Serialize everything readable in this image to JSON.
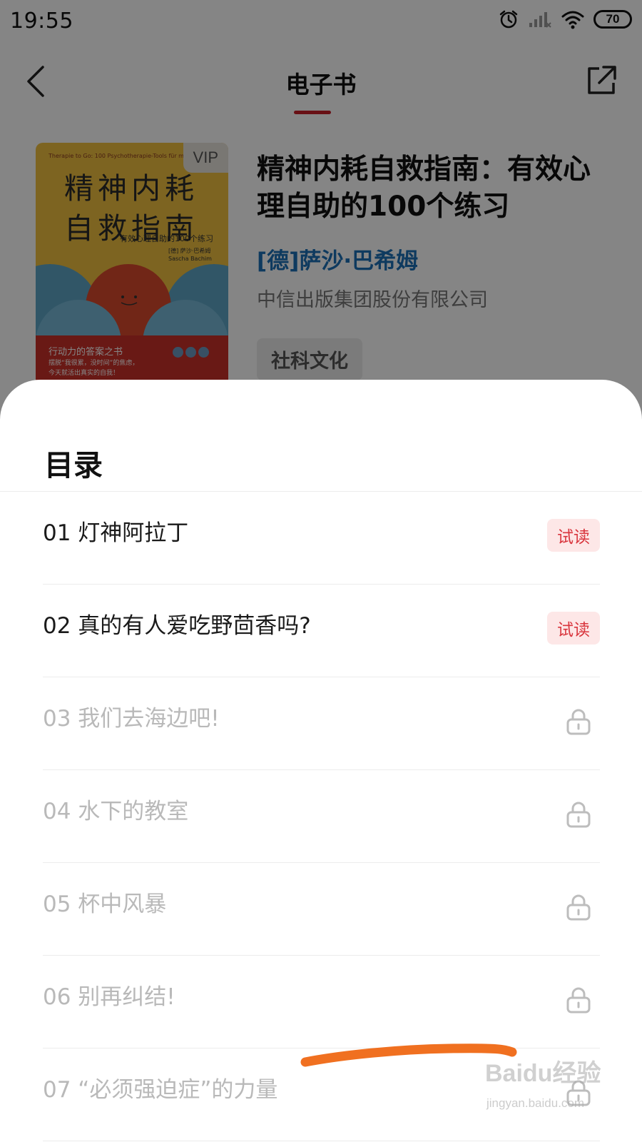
{
  "status_bar": {
    "time": "19:55",
    "battery": "70"
  },
  "header": {
    "title": "电子书"
  },
  "book": {
    "vip_label": "VIP",
    "cover": {
      "english_subtitle": "Therapie to Go: 100 Psychotherapie-Tools für mehr Leichtigkeit",
      "title_line1": "精神内耗",
      "title_line2": "自救指南",
      "subtitle": "有效心理自助的100个练习",
      "author_line1": "[德] 萨沙·巴希姆",
      "author_line2": "Sascha Bachim",
      "band_title": "行动力的答案之书",
      "band_line1": "摆脱“我很累，没时间”的焦虑，",
      "band_line2": "今天就活出真实的自我！"
    },
    "title": "精神内耗自救指南：有效心理自助的100个练习",
    "author": "[德]萨沙·巴希姆",
    "publisher": "中信出版集团股份有限公司",
    "category": "社科文化"
  },
  "toc": {
    "heading": "目录",
    "trial_label": "试读",
    "items": [
      {
        "label": "01 灯神阿拉丁",
        "state": "trial"
      },
      {
        "label": "02 真的有人爱吃野茴香吗?",
        "state": "trial"
      },
      {
        "label": "03 我们去海边吧!",
        "state": "locked"
      },
      {
        "label": "04 水下的教室",
        "state": "locked"
      },
      {
        "label": "05 杯中风暴",
        "state": "locked"
      },
      {
        "label": "06 别再纠结!",
        "state": "locked"
      },
      {
        "label": "07 “必须强迫症”的力量",
        "state": "locked"
      }
    ]
  },
  "watermark": {
    "logo_text": "Baidu经验",
    "url": "jingyan.baidu.com"
  },
  "colors": {
    "accent": "#c8202a",
    "author_link": "#1b6fb6",
    "trial_text": "#d9363e",
    "trial_bg": "#fde7e7",
    "locked_text": "#b9b9b9",
    "scribble": "#f07020"
  }
}
